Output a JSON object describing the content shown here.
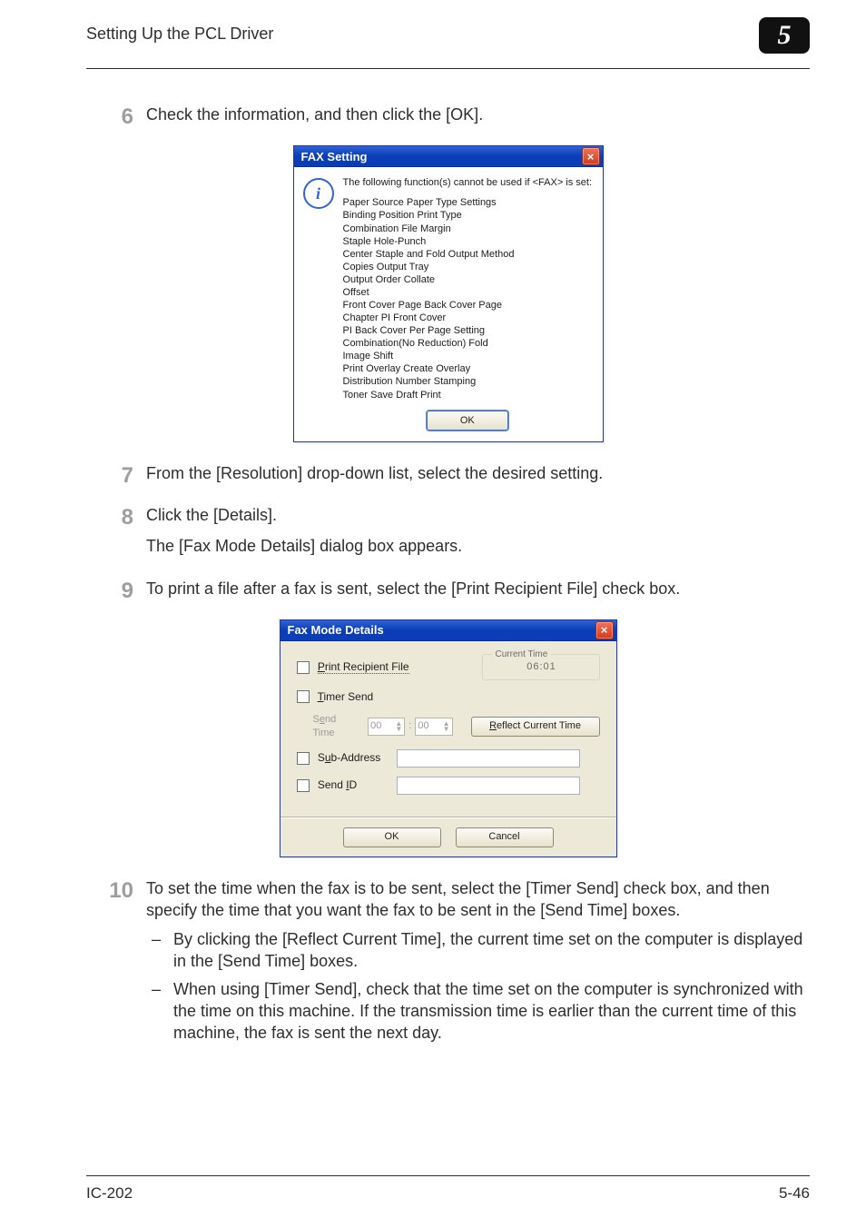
{
  "header": {
    "title": "Setting Up the PCL Driver",
    "chapter": "5"
  },
  "footer": {
    "left": "IC-202",
    "right": "5-46"
  },
  "steps": {
    "s6": {
      "num": "6",
      "text": "Check the information, and then click the [OK]."
    },
    "s7": {
      "num": "7",
      "text": "From the [Resolution] drop-down list, select the desired setting."
    },
    "s8": {
      "num": "8",
      "text1": "Click the [Details].",
      "text2": "The [Fax Mode Details] dialog box appears."
    },
    "s9": {
      "num": "9",
      "text": "To print a file after a fax is sent, select the [Print Recipient File] check box."
    },
    "s10": {
      "num": "10",
      "text": "To set the time when the fax is to be sent, select the [Timer Send] check box, and then specify the time that you want the fax to be sent in the [Send Time] boxes.",
      "bul1": "By clicking the [Reflect Current Time], the current time set on the computer is displayed in the [Send Time] boxes.",
      "bul2": "When using [Timer Send], check that the time set on the computer is synchronized with the time on this machine. If the transmission time is earlier than the current time of this machine, the fax is sent the next day."
    }
  },
  "dlg1": {
    "title": "FAX Setting",
    "lead": "The following function(s) cannot be used if <FAX> is set:",
    "lines": [
      "Paper Source   Paper Type Settings",
      "Binding Position   Print Type",
      "Combination   File Margin",
      "Staple   Hole-Punch",
      "Center Staple and Fold   Output Method",
      "Copies   Output Tray",
      "Output Order   Collate",
      "Offset",
      "Front Cover Page   Back Cover Page",
      "Chapter   PI Front Cover",
      "PI Back Cover   Per Page Setting",
      "Combination(No Reduction)   Fold",
      "Image Shift",
      "Print Overlay   Create Overlay",
      "Distribution Number Stamping",
      "Toner Save   Draft Print"
    ],
    "ok": "OK"
  },
  "dlg2": {
    "title": "Fax Mode Details",
    "chk_print": "Print Recipient File",
    "chk_timer": "Timer Send",
    "chk_sub": "Sub-Address",
    "chk_id": "Send ID",
    "send_time_label": "Send Time",
    "spin_h": "00",
    "spin_m": "00",
    "colon": ":",
    "reflect": "Reflect Current Time",
    "ctlabel": "Current Time",
    "ctval": "06:01",
    "ok": "OK",
    "cancel": "Cancel"
  }
}
